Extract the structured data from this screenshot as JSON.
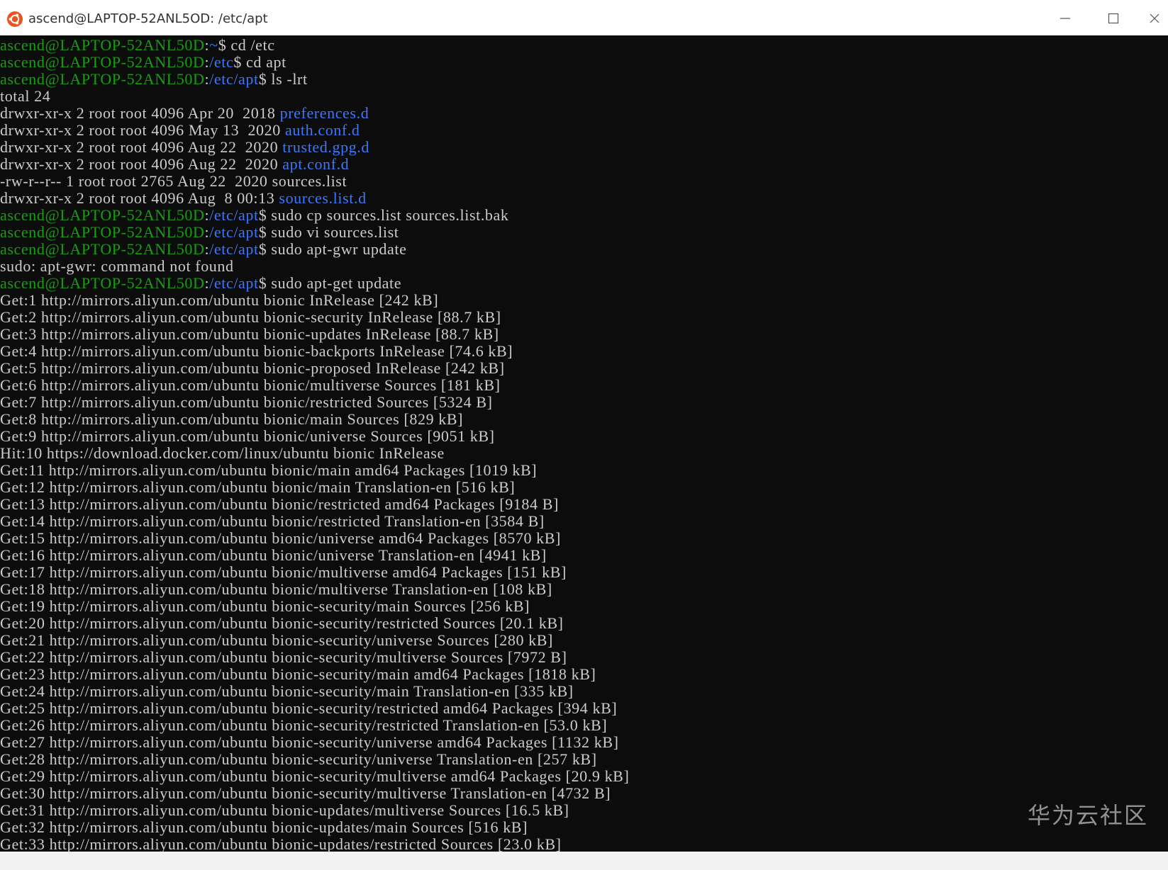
{
  "window": {
    "title": "ascend@LAPTOP-52ANL5OD: /etc/apt",
    "icon": "ubuntu-icon",
    "controls": [
      "minimize-icon",
      "maximize-icon",
      "close-icon"
    ]
  },
  "colors": {
    "prompt_user": "#13a10e",
    "path": "#3b78ff",
    "text": "#cccccc",
    "background": "#0c0c0c"
  },
  "terminal": {
    "lines": [
      [
        {
          "t": "ascend@LAPTOP-52ANL50D",
          "c": "green"
        },
        {
          "t": ":",
          "c": "white"
        },
        {
          "t": "~",
          "c": "blue"
        },
        {
          "t": "$ cd /etc",
          "c": "white"
        }
      ],
      [
        {
          "t": "ascend@LAPTOP-52ANL50D",
          "c": "green"
        },
        {
          "t": ":",
          "c": "white"
        },
        {
          "t": "/etc",
          "c": "blue"
        },
        {
          "t": "$ cd apt",
          "c": "white"
        }
      ],
      [
        {
          "t": "ascend@LAPTOP-52ANL50D",
          "c": "green"
        },
        {
          "t": ":",
          "c": "white"
        },
        {
          "t": "/etc/apt",
          "c": "blue"
        },
        {
          "t": "$ ls -lrt",
          "c": "white"
        }
      ],
      [
        {
          "t": "total 24",
          "c": "white"
        }
      ],
      [
        {
          "t": "drwxr-xr-x 2 root root 4096 Apr 20  2018 ",
          "c": "white"
        },
        {
          "t": "preferences.d",
          "c": "blue"
        }
      ],
      [
        {
          "t": "drwxr-xr-x 2 root root 4096 May 13  2020 ",
          "c": "white"
        },
        {
          "t": "auth.conf.d",
          "c": "blue"
        }
      ],
      [
        {
          "t": "drwxr-xr-x 2 root root 4096 Aug 22  2020 ",
          "c": "white"
        },
        {
          "t": "trusted.gpg.d",
          "c": "blue"
        }
      ],
      [
        {
          "t": "drwxr-xr-x 2 root root 4096 Aug 22  2020 ",
          "c": "white"
        },
        {
          "t": "apt.conf.d",
          "c": "blue"
        }
      ],
      [
        {
          "t": "-rw-r--r-- 1 root root 2765 Aug 22  2020 sources.list",
          "c": "white"
        }
      ],
      [
        {
          "t": "drwxr-xr-x 2 root root 4096 Aug  8 00:13 ",
          "c": "white"
        },
        {
          "t": "sources.list.d",
          "c": "blue"
        }
      ],
      [
        {
          "t": "ascend@LAPTOP-52ANL50D",
          "c": "green"
        },
        {
          "t": ":",
          "c": "white"
        },
        {
          "t": "/etc/apt",
          "c": "blue"
        },
        {
          "t": "$ sudo cp sources.list sources.list.bak",
          "c": "white"
        }
      ],
      [
        {
          "t": "ascend@LAPTOP-52ANL50D",
          "c": "green"
        },
        {
          "t": ":",
          "c": "white"
        },
        {
          "t": "/etc/apt",
          "c": "blue"
        },
        {
          "t": "$ sudo vi sources.list",
          "c": "white"
        }
      ],
      [
        {
          "t": "ascend@LAPTOP-52ANL50D",
          "c": "green"
        },
        {
          "t": ":",
          "c": "white"
        },
        {
          "t": "/etc/apt",
          "c": "blue"
        },
        {
          "t": "$ sudo apt-gwr update",
          "c": "white"
        }
      ],
      [
        {
          "t": "sudo: apt-gwr: command not found",
          "c": "white"
        }
      ],
      [
        {
          "t": "ascend@LAPTOP-52ANL50D",
          "c": "green"
        },
        {
          "t": ":",
          "c": "white"
        },
        {
          "t": "/etc/apt",
          "c": "blue"
        },
        {
          "t": "$ sudo apt-get update",
          "c": "white"
        }
      ],
      [
        {
          "t": "Get:1 http://mirrors.aliyun.com/ubuntu bionic InRelease [242 kB]",
          "c": "white"
        }
      ],
      [
        {
          "t": "Get:2 http://mirrors.aliyun.com/ubuntu bionic-security InRelease [88.7 kB]",
          "c": "white"
        }
      ],
      [
        {
          "t": "Get:3 http://mirrors.aliyun.com/ubuntu bionic-updates InRelease [88.7 kB]",
          "c": "white"
        }
      ],
      [
        {
          "t": "Get:4 http://mirrors.aliyun.com/ubuntu bionic-backports InRelease [74.6 kB]",
          "c": "white"
        }
      ],
      [
        {
          "t": "Get:5 http://mirrors.aliyun.com/ubuntu bionic-proposed InRelease [242 kB]",
          "c": "white"
        }
      ],
      [
        {
          "t": "Get:6 http://mirrors.aliyun.com/ubuntu bionic/multiverse Sources [181 kB]",
          "c": "white"
        }
      ],
      [
        {
          "t": "Get:7 http://mirrors.aliyun.com/ubuntu bionic/restricted Sources [5324 B]",
          "c": "white"
        }
      ],
      [
        {
          "t": "Get:8 http://mirrors.aliyun.com/ubuntu bionic/main Sources [829 kB]",
          "c": "white"
        }
      ],
      [
        {
          "t": "Get:9 http://mirrors.aliyun.com/ubuntu bionic/universe Sources [9051 kB]",
          "c": "white"
        }
      ],
      [
        {
          "t": "Hit:10 https://download.docker.com/linux/ubuntu bionic InRelease",
          "c": "white"
        }
      ],
      [
        {
          "t": "Get:11 http://mirrors.aliyun.com/ubuntu bionic/main amd64 Packages [1019 kB]",
          "c": "white"
        }
      ],
      [
        {
          "t": "Get:12 http://mirrors.aliyun.com/ubuntu bionic/main Translation-en [516 kB]",
          "c": "white"
        }
      ],
      [
        {
          "t": "Get:13 http://mirrors.aliyun.com/ubuntu bionic/restricted amd64 Packages [9184 B]",
          "c": "white"
        }
      ],
      [
        {
          "t": "Get:14 http://mirrors.aliyun.com/ubuntu bionic/restricted Translation-en [3584 B]",
          "c": "white"
        }
      ],
      [
        {
          "t": "Get:15 http://mirrors.aliyun.com/ubuntu bionic/universe amd64 Packages [8570 kB]",
          "c": "white"
        }
      ],
      [
        {
          "t": "Get:16 http://mirrors.aliyun.com/ubuntu bionic/universe Translation-en [4941 kB]",
          "c": "white"
        }
      ],
      [
        {
          "t": "Get:17 http://mirrors.aliyun.com/ubuntu bionic/multiverse amd64 Packages [151 kB]",
          "c": "white"
        }
      ],
      [
        {
          "t": "Get:18 http://mirrors.aliyun.com/ubuntu bionic/multiverse Translation-en [108 kB]",
          "c": "white"
        }
      ],
      [
        {
          "t": "Get:19 http://mirrors.aliyun.com/ubuntu bionic-security/main Sources [256 kB]",
          "c": "white"
        }
      ],
      [
        {
          "t": "Get:20 http://mirrors.aliyun.com/ubuntu bionic-security/restricted Sources [20.1 kB]",
          "c": "white"
        }
      ],
      [
        {
          "t": "Get:21 http://mirrors.aliyun.com/ubuntu bionic-security/universe Sources [280 kB]",
          "c": "white"
        }
      ],
      [
        {
          "t": "Get:22 http://mirrors.aliyun.com/ubuntu bionic-security/multiverse Sources [7972 B]",
          "c": "white"
        }
      ],
      [
        {
          "t": "Get:23 http://mirrors.aliyun.com/ubuntu bionic-security/main amd64 Packages [1818 kB]",
          "c": "white"
        }
      ],
      [
        {
          "t": "Get:24 http://mirrors.aliyun.com/ubuntu bionic-security/main Translation-en [335 kB]",
          "c": "white"
        }
      ],
      [
        {
          "t": "Get:25 http://mirrors.aliyun.com/ubuntu bionic-security/restricted amd64 Packages [394 kB]",
          "c": "white"
        }
      ],
      [
        {
          "t": "Get:26 http://mirrors.aliyun.com/ubuntu bionic-security/restricted Translation-en [53.0 kB]",
          "c": "white"
        }
      ],
      [
        {
          "t": "Get:27 http://mirrors.aliyun.com/ubuntu bionic-security/universe amd64 Packages [1132 kB]",
          "c": "white"
        }
      ],
      [
        {
          "t": "Get:28 http://mirrors.aliyun.com/ubuntu bionic-security/universe Translation-en [257 kB]",
          "c": "white"
        }
      ],
      [
        {
          "t": "Get:29 http://mirrors.aliyun.com/ubuntu bionic-security/multiverse amd64 Packages [20.9 kB]",
          "c": "white"
        }
      ],
      [
        {
          "t": "Get:30 http://mirrors.aliyun.com/ubuntu bionic-security/multiverse Translation-en [4732 B]",
          "c": "white"
        }
      ],
      [
        {
          "t": "Get:31 http://mirrors.aliyun.com/ubuntu bionic-updates/multiverse Sources [16.5 kB]",
          "c": "white"
        }
      ],
      [
        {
          "t": "Get:32 http://mirrors.aliyun.com/ubuntu bionic-updates/main Sources [516 kB]",
          "c": "white"
        }
      ],
      [
        {
          "t": "Get:33 http://mirrors.aliyun.com/ubuntu bionic-updates/restricted Sources [23.0 kB]",
          "c": "white"
        }
      ]
    ]
  },
  "watermark": "华为云社区"
}
